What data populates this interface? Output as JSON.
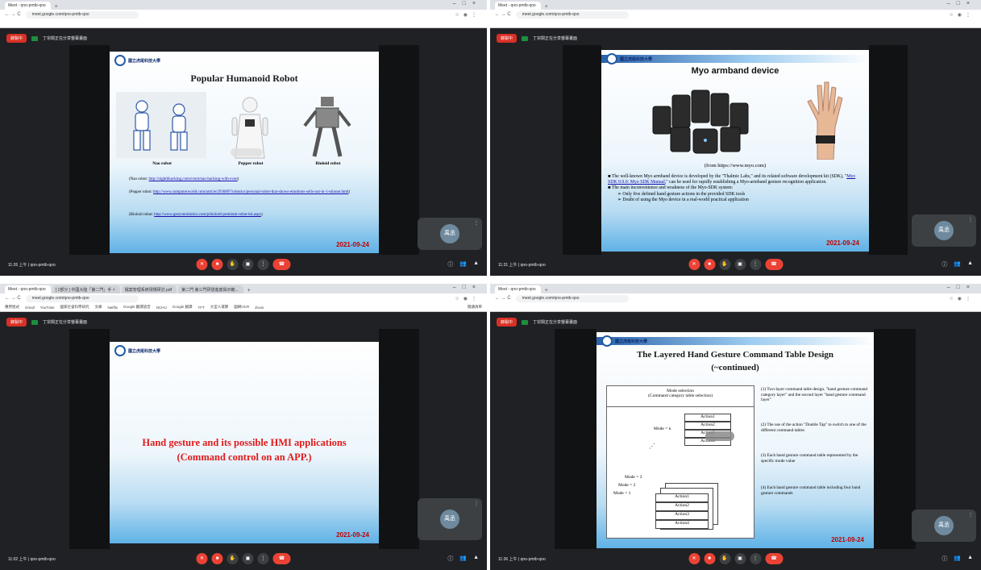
{
  "panels": [
    {
      "tabs": [
        "Meet - qno-pmtb-qoo"
      ],
      "url": "meet.google.com/qno-pmtb-qoo",
      "presenting": {
        "rec": "錄製中",
        "label": "丁宗閔正在分享螢幕畫面"
      },
      "slide": {
        "title": "Popular Humanoid Robot",
        "institution": "國立虎尾科技大學",
        "captions": [
          "Nao robot",
          "Pepper robot",
          "Bioloid robot"
        ],
        "links": [
          {
            "prefix": "(Nao robot: ",
            "url": "http://nightbhacking.com/event/nao-hacking-with-sven",
            "suffix": ")"
          },
          {
            "prefix": "(Pepper robot: ",
            "url": "http://www.computerworld.com/article/2930897/robotics/personal-robot-that-shows-emotions-sells-out-in-1-minute.html",
            "suffix": ")"
          },
          {
            "prefix": "(Bioloid robot: ",
            "url": "http://www.geeyonrobotics.com/p/bioloid-premium-robot-kit.aspx",
            "suffix": ")"
          }
        ],
        "date": "2021-09-24"
      },
      "participant": "禹丞",
      "meeting": "11:26 上午 | qno-pmtb-qoo"
    },
    {
      "tabs": [
        "Meet - qno-pmtb-qoo"
      ],
      "url": "meet.google.com/qno-pmtb-qoo",
      "presenting": {
        "rec": "錄製中",
        "label": "丁宗閔正在分享螢幕畫面"
      },
      "slide": {
        "title": "Myo armband device",
        "institution": "國立虎尾科技大學",
        "source": "(from https://www.myo.com)",
        "bullet1_a": "The well-known Myo armband device is developed by the \"Thalmic Labs,\" and its related software development kit (SDK), \"",
        "bullet1_link": "Myo SDK 0.9.0: Myo SDK Manual",
        "bullet1_b": ",\" can be used for rapidly establishing a Myo-armband gesture recognition application.",
        "bullet2": "The main inconvenience and weakness of the Myo-SDK system:",
        "sub1": "Only five defined hand gesture actions in the provided SDK tools",
        "sub2": "Doubt of using the Myo device in a real-world practical application",
        "date": "2021-09-24"
      },
      "participant": "禹丞",
      "meeting": "11:31 上午 | qno-pmtb-qoo"
    },
    {
      "tabs": [
        "Meet - qno-pmtb-qoo",
        "[ 1部分 ] 中國大陸「第二門」手 ×",
        "檔案管理系統現場研討.pdf",
        "第二門 第三門研發進度與示範..."
      ],
      "url": "meet.google.com/qno-pmtb-qoo",
      "bookmarks": [
        "應用程式",
        "Gmail",
        "YouTube",
        "國家社會科學研究",
        "文庫",
        "Netflix",
        "Google 翻譯語音",
        "NCHU",
        "Google 翻譯",
        "TFT",
        "大型人運算",
        "國網OCR",
        "Zuvio"
      ],
      "bookmarks_end": "閱讀清單",
      "presenting": {
        "rec": "錄製中",
        "label": "丁宗閔正在分享螢幕畫面"
      },
      "slide": {
        "line1": "Hand gesture and its possible HMI applications",
        "line2": "(Command control on an APP.)",
        "institution": "國立虎尾科技大學",
        "date": "2021-09-24"
      },
      "participant": "禹丞",
      "meeting": "11:02 上午 | qno-pmtb-qoo"
    },
    {
      "tabs": [
        "Meet - qno-pmtb-qoo"
      ],
      "url": "meet.google.com/qno-pmtb-qoo",
      "presenting": {
        "rec": "錄製中",
        "label": "丁宗閔正在分享螢幕畫面"
      },
      "slide": {
        "title": "The Layered Hand Gesture Command Table Design",
        "subtitle": "(~continued)",
        "institution": "國立虎尾科技大學",
        "mode_selection": "Mode selection",
        "mode_sub": "(Command category table selection)",
        "actions": [
          "Action1",
          "Action2",
          "Action3",
          "Action4"
        ],
        "mode_n": "Mode = n",
        "modes": [
          "Mode = 3",
          "Mode = 2",
          "Mode = 1"
        ],
        "notes": [
          "(1) Two-layer command table design, \"hand gesture command category layer\" and the second layer \"hand gesture command layer\"",
          "(2) The use of the action \"Double Tap\" to switch to one of the different command tables",
          "(3) Each hand gesture command table represented by the specific mode value",
          "(4) Each hand gesture command table including four hand gesture commands"
        ],
        "date": "2021-09-24"
      },
      "participant": "禹丞",
      "meeting": "11:36 上午 | qno-pmtb-qoo"
    }
  ],
  "colors": {
    "meet_bg": "#202124",
    "rec": "#d93025",
    "end_call": "#ea4335",
    "date": "#c00000",
    "title_red": "#e01b1b"
  }
}
